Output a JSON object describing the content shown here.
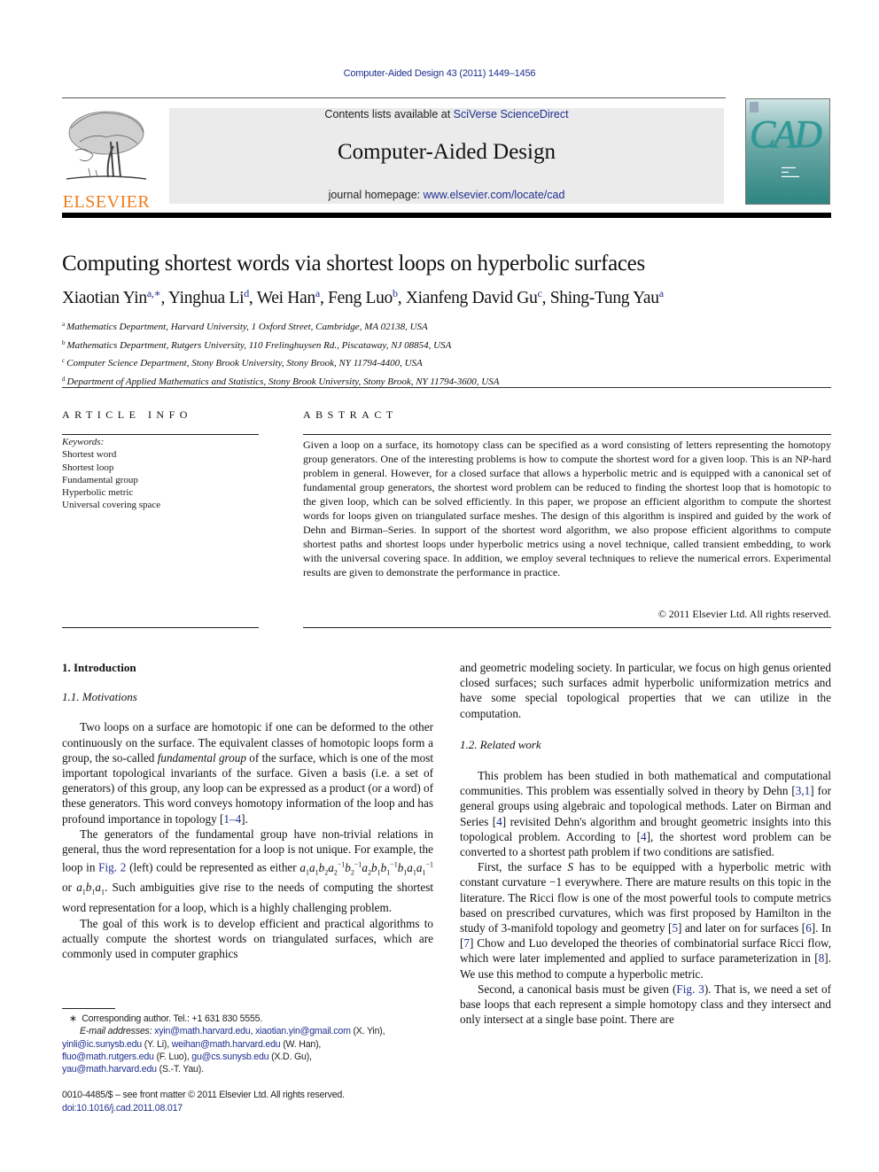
{
  "header": {
    "citation": "Computer-Aided Design 43 (2011) 1449–1456",
    "publisher_logo_text": "ELSEVIER",
    "contents_prefix": "Contents lists available at ",
    "contents_link": "SciVerse ScienceDirect",
    "journal_name": "Computer-Aided Design",
    "homepage_prefix": "journal homepage: ",
    "homepage_link": "www.elsevier.com/locate/cad",
    "cover_text": "CAD"
  },
  "article": {
    "title": "Computing shortest words via shortest loops on hyperbolic surfaces",
    "authors": [
      {
        "name": "Xiaotian Yin",
        "sup": "a,∗"
      },
      {
        "name": "Yinghua Li",
        "sup": "d"
      },
      {
        "name": "Wei Han",
        "sup": "a"
      },
      {
        "name": "Feng Luo",
        "sup": "b"
      },
      {
        "name": "Xianfeng David Gu",
        "sup": "c"
      },
      {
        "name": "Shing-Tung Yau",
        "sup": "a"
      }
    ],
    "affiliations": [
      {
        "key": "a",
        "text": "Mathematics Department, Harvard University, 1 Oxford Street, Cambridge, MA 02138, USA"
      },
      {
        "key": "b",
        "text": "Mathematics Department, Rutgers University, 110 Frelinghuysen Rd., Piscataway, NJ 08854, USA"
      },
      {
        "key": "c",
        "text": "Computer Science Department, Stony Brook University, Stony Brook, NY 11794-4400, USA"
      },
      {
        "key": "d",
        "text": "Department of Applied Mathematics and Statistics, Stony Brook University, Stony Brook, NY 11794-3600, USA"
      }
    ]
  },
  "article_info": {
    "heading": "ARTICLE INFO",
    "keywords_label": "Keywords:",
    "keywords": [
      "Shortest word",
      "Shortest loop",
      "Fundamental group",
      "Hyperbolic metric",
      "Universal covering space"
    ]
  },
  "abstract": {
    "heading": "ABSTRACT",
    "text": "Given a loop on a surface, its homotopy class can be specified as a word consisting of letters representing the homotopy group generators. One of the interesting problems is how to compute the shortest word for a given loop. This is an NP-hard problem in general. However, for a closed surface that allows a hyperbolic metric and is equipped with a canonical set of fundamental group generators, the shortest word problem can be reduced to finding the shortest loop that is homotopic to the given loop, which can be solved efficiently. In this paper, we propose an efficient algorithm to compute the shortest words for loops given on triangulated surface meshes. The design of this algorithm is inspired and guided by the work of Dehn and Birman–Series. In support of the shortest word algorithm, we also propose efficient algorithms to compute shortest paths and shortest loops under hyperbolic metrics using a novel technique, called transient embedding, to work with the universal covering space. In addition, we employ several techniques to relieve the numerical errors. Experimental results are given to demonstrate the performance in practice.",
    "copyright": "© 2011 Elsevier Ltd. All rights reserved."
  },
  "body": {
    "section1": "1.  Introduction",
    "section1_1": "1.1.  Motivations",
    "p1_a": "Two loops on a surface are homotopic if one can be deformed to the other continuously on the surface. The equivalent classes of homotopic loops form a group, the so-called ",
    "p1_em": "fundamental group",
    "p1_b": " of the surface, which is one of the most important topological invariants of the surface. Given a basis (i.e. a set of generators) of this group, any loop can be expressed as a product (or a word) of these generators. This word conveys homotopy information of the loop and has profound importance in topology [",
    "p1_ref": "1–4",
    "p1_c": "].",
    "p2_a": "The generators of the fundamental group have non-trivial relations in general, thus the word representation for a loop is not unique. For example, the loop in ",
    "p2_fig": "Fig. 2",
    "p2_b": " (left) could be represented as either ",
    "p2_or": " or ",
    "p2_c": ". Such ambiguities give rise to the needs of computing the shortest word representation for a loop, which is a highly challenging problem.",
    "p3": "The goal of this work is to develop efficient and practical algorithms to actually compute the shortest words on triangulated surfaces, which are commonly used in computer graphics",
    "p3_cont": "and geometric modeling society. In particular, we focus on high genus oriented closed surfaces; such surfaces admit hyperbolic uniformization metrics and have some special topological properties that we can utilize in the computation.",
    "section1_2": "1.2.  Related work",
    "p4_a": "This problem has been studied in both mathematical and computational communities. This problem was essentially solved in theory by Dehn [",
    "p4_ref1": "3,1",
    "p4_b": "] for general groups using algebraic and topological methods. Later on Birman and Series [",
    "p4_ref2": "4",
    "p4_c": "] revisited Dehn's algorithm and brought geometric insights into this topological problem. According to [",
    "p4_ref3": "4",
    "p4_d": "], the shortest word problem can be converted to a shortest path problem if two conditions are satisfied.",
    "p5_a": "First, the surface ",
    "p5_S": "S",
    "p5_b": " has to be equipped with a hyperbolic metric with constant curvature −1 everywhere. There are mature results on this topic in the literature. The Ricci flow is one of the most powerful tools to compute metrics based on prescribed curvatures, which was first proposed by Hamilton in the study of 3-manifold topology and geometry [",
    "p5_ref5": "5",
    "p5_c": "] and later on for surfaces [",
    "p5_ref6": "6",
    "p5_d": "]. In [",
    "p5_ref7": "7",
    "p5_e": "] Chow and Luo developed the theories of combinatorial surface Ricci flow, which were later implemented and applied to surface parameterization in [",
    "p5_ref8": "8",
    "p5_f": "]. We use this method to compute a hyperbolic metric.",
    "p6_a": "Second, a canonical basis must be given (",
    "p6_fig": "Fig. 3",
    "p6_b": "). That is, we need a set of base loops that each represent a simple homotopy class and they intersect and only intersect at a single base point. There are"
  },
  "footnote": {
    "star": "∗",
    "corresponding": "Corresponding author. Tel.: +1 631 830 5555.",
    "email_label": "E-mail addresses:",
    "emails": [
      {
        "addr": "xyin@math.harvard.edu",
        "who": ""
      },
      {
        "addr": "xiaotian.yin@gmail.com",
        "who": "(X. Yin),"
      },
      {
        "addr": "yinli@ic.sunysb.edu",
        "who": "(Y. Li),"
      },
      {
        "addr": "weihan@math.harvard.edu",
        "who": "(W. Han),"
      },
      {
        "addr": "fluo@math.rutgers.edu",
        "who": "(F. Luo),"
      },
      {
        "addr": "gu@cs.sunysb.edu",
        "who": "(X.D. Gu),"
      },
      {
        "addr": "yau@math.harvard.edu",
        "who": "(S.-T. Yau)."
      }
    ],
    "front_matter": "0010-4485/$ – see front matter © 2011 Elsevier Ltd. All rights reserved.",
    "doi": "doi:10.1016/j.cad.2011.08.017"
  },
  "colors": {
    "link": "#1f2f8f",
    "elsevier_orange": "#f07c1a",
    "banner_gray": "#ebebeb",
    "cover_teal": "#2e8581"
  }
}
